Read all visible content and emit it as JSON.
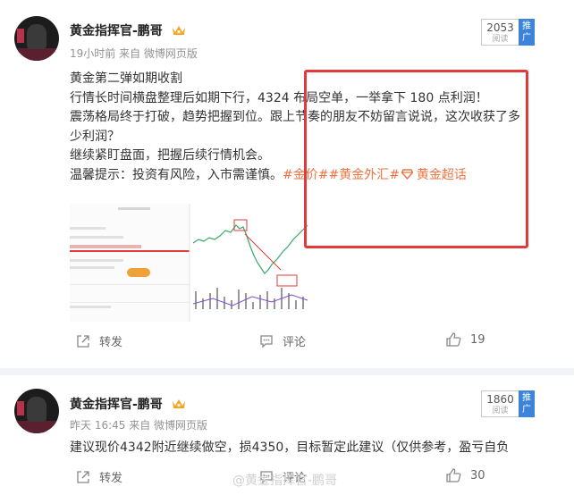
{
  "posts": [
    {
      "author": "黄金指挥官-鹏哥",
      "meta": "19小时前 来自 微博网页版",
      "read_count": "2053",
      "read_label": "阅读",
      "promote": "推广",
      "lines": [
        "黄金第二弹如期收割",
        "行情长时间横盘整理后如期下行，4324 布局空单，一举拿下 180 点利润！",
        "震荡格局终于打破，趋势把握到位。跟上节奏的朋友不妨留言说说，这次收获了多",
        "少利润？",
        "继续紧盯盘面，把握后续行情机会。"
      ],
      "tip_prefix": "温馨提示：投资有风险，入市需谨慎。",
      "hashtags": "#金价##黄金外汇#",
      "supertopic": "黄金超话",
      "actions": {
        "share": "转发",
        "comment": "评论",
        "likes": "19"
      }
    },
    {
      "author": "黄金指挥官-鹏哥",
      "meta": "昨天 16:45 来自 微博网页版",
      "read_count": "1860",
      "read_label": "阅读",
      "promote": "推广",
      "text": "建议现价4342附近继续做空，损4350，目标暂定此建议（仅供参考，盈亏自负",
      "actions": {
        "share": "转发",
        "comment": "评论",
        "likes": "30"
      }
    }
  ],
  "watermark": "@黄金指挥官-鹏哥",
  "accent": "#eb7340",
  "highlight_box_color": "#e23a3a"
}
